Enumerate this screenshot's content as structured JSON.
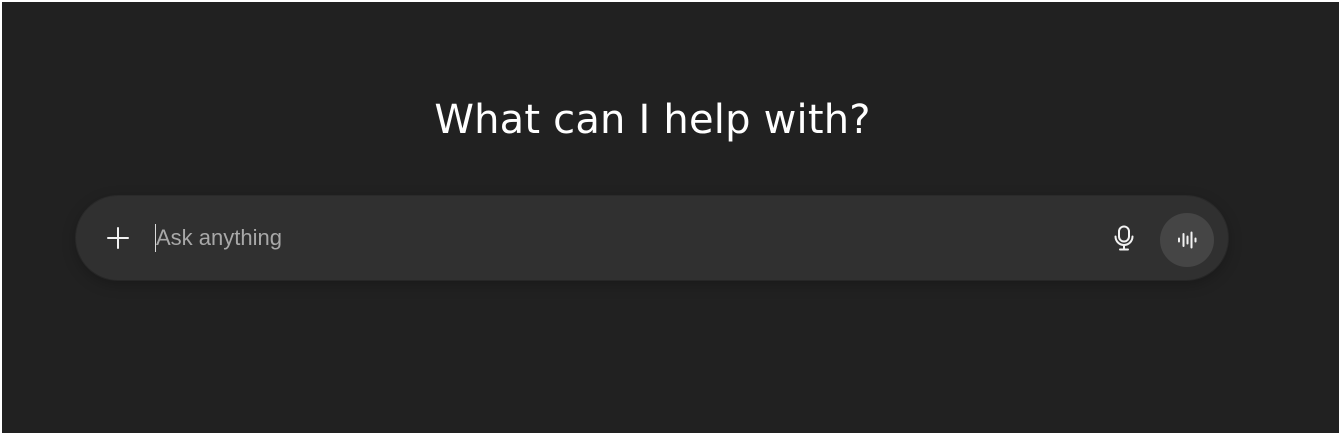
{
  "main": {
    "headline": "What can I help with?"
  },
  "composer": {
    "placeholder": "Ask anything",
    "value": "",
    "add_icon": "plus-icon",
    "dictate_icon": "microphone-icon",
    "voice_mode_icon": "voice-waveform-icon"
  },
  "colors": {
    "background": "#212121",
    "composer_background": "#303030",
    "voice_button_background": "#454545",
    "text": "#ffffff",
    "placeholder": "#a8a8a8"
  }
}
